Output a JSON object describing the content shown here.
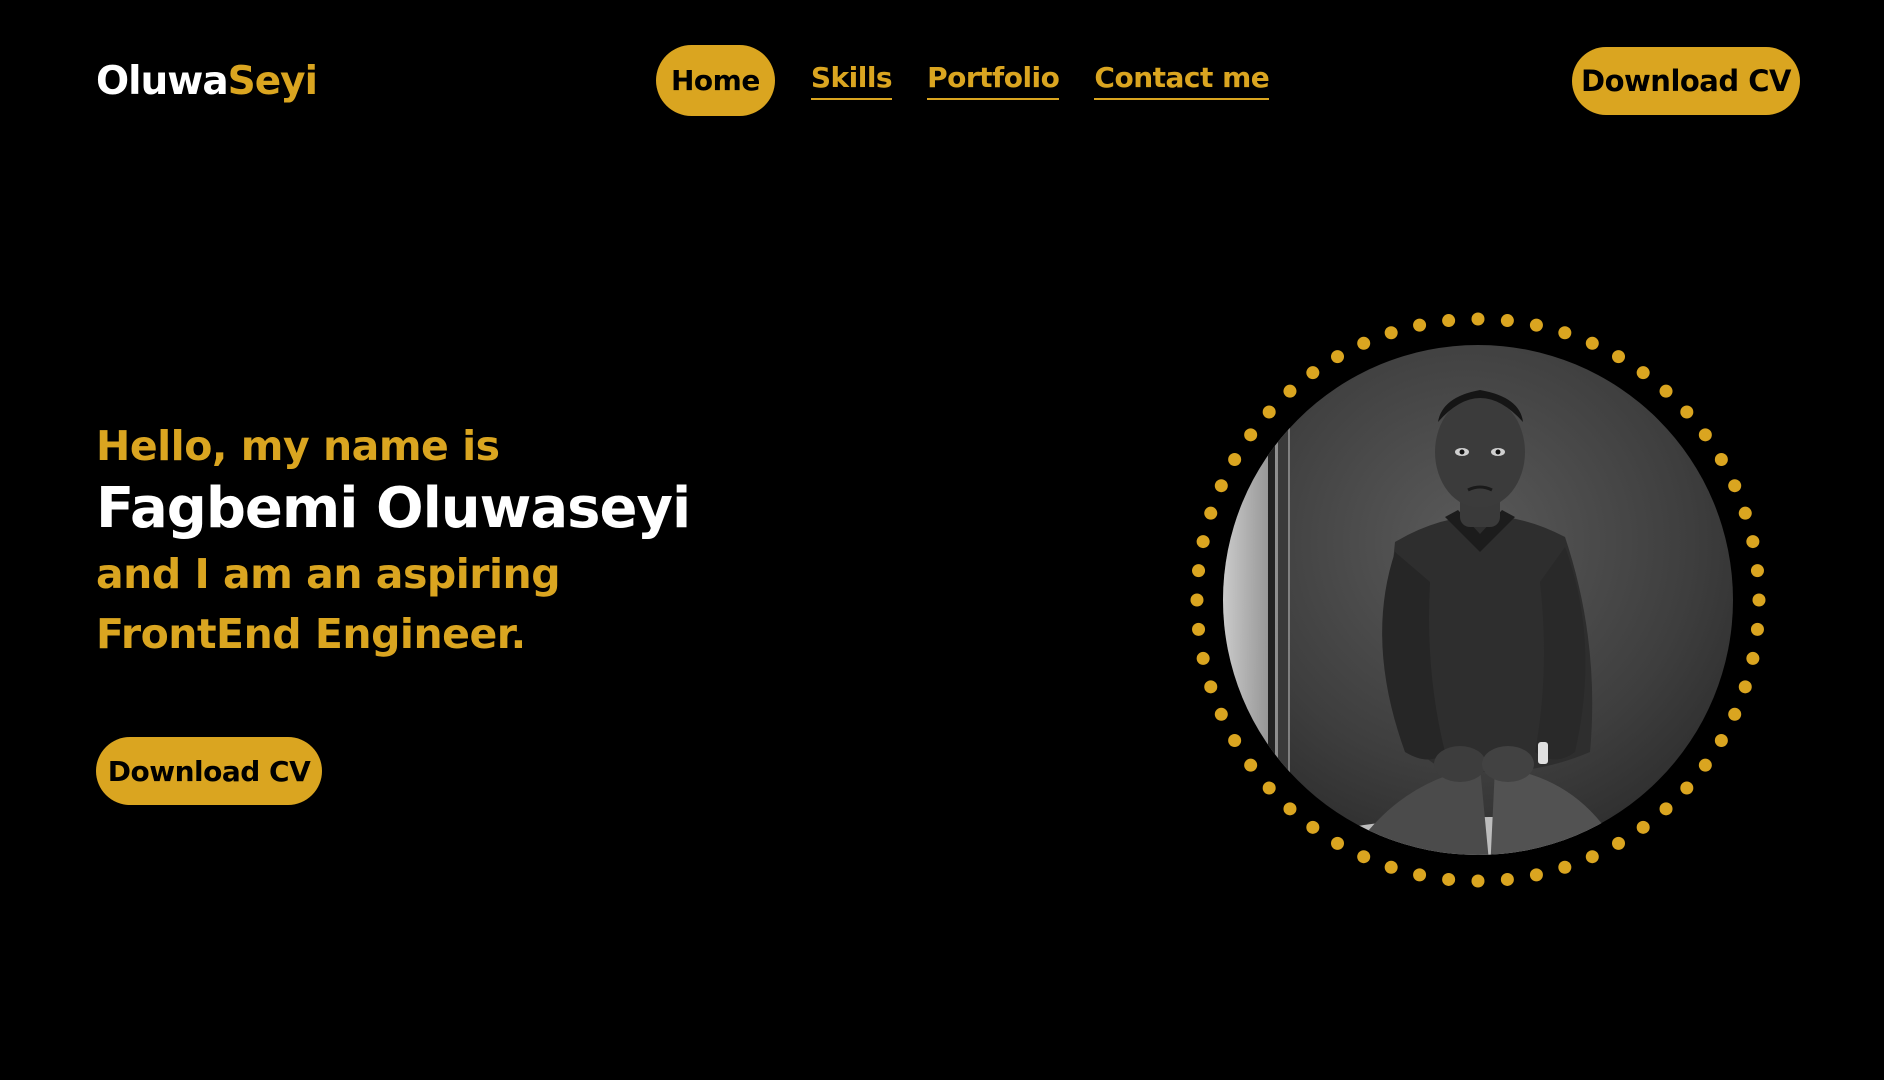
{
  "brand": {
    "part1": "Oluwa",
    "part2": "Seyi"
  },
  "nav": {
    "items": [
      {
        "label": "Home",
        "active": true
      },
      {
        "label": "Skills",
        "active": false
      },
      {
        "label": "Portfolio",
        "active": false
      },
      {
        "label": "Contact me",
        "active": false
      }
    ]
  },
  "header": {
    "cta_label": "Download CV"
  },
  "hero": {
    "greeting": "Hello, my name is",
    "name": "Fagbemi Oluwaseyi",
    "tagline_line1": "and I am an aspiring",
    "tagline_line2": "FrontEnd Engineer.",
    "cta_label": "Download CV"
  },
  "portrait": {
    "icon": "profile-photo",
    "frame": "dotted-ring"
  },
  "colors": {
    "accent": "#DAA520",
    "background": "#000000",
    "text_primary": "#FFFFFF"
  }
}
